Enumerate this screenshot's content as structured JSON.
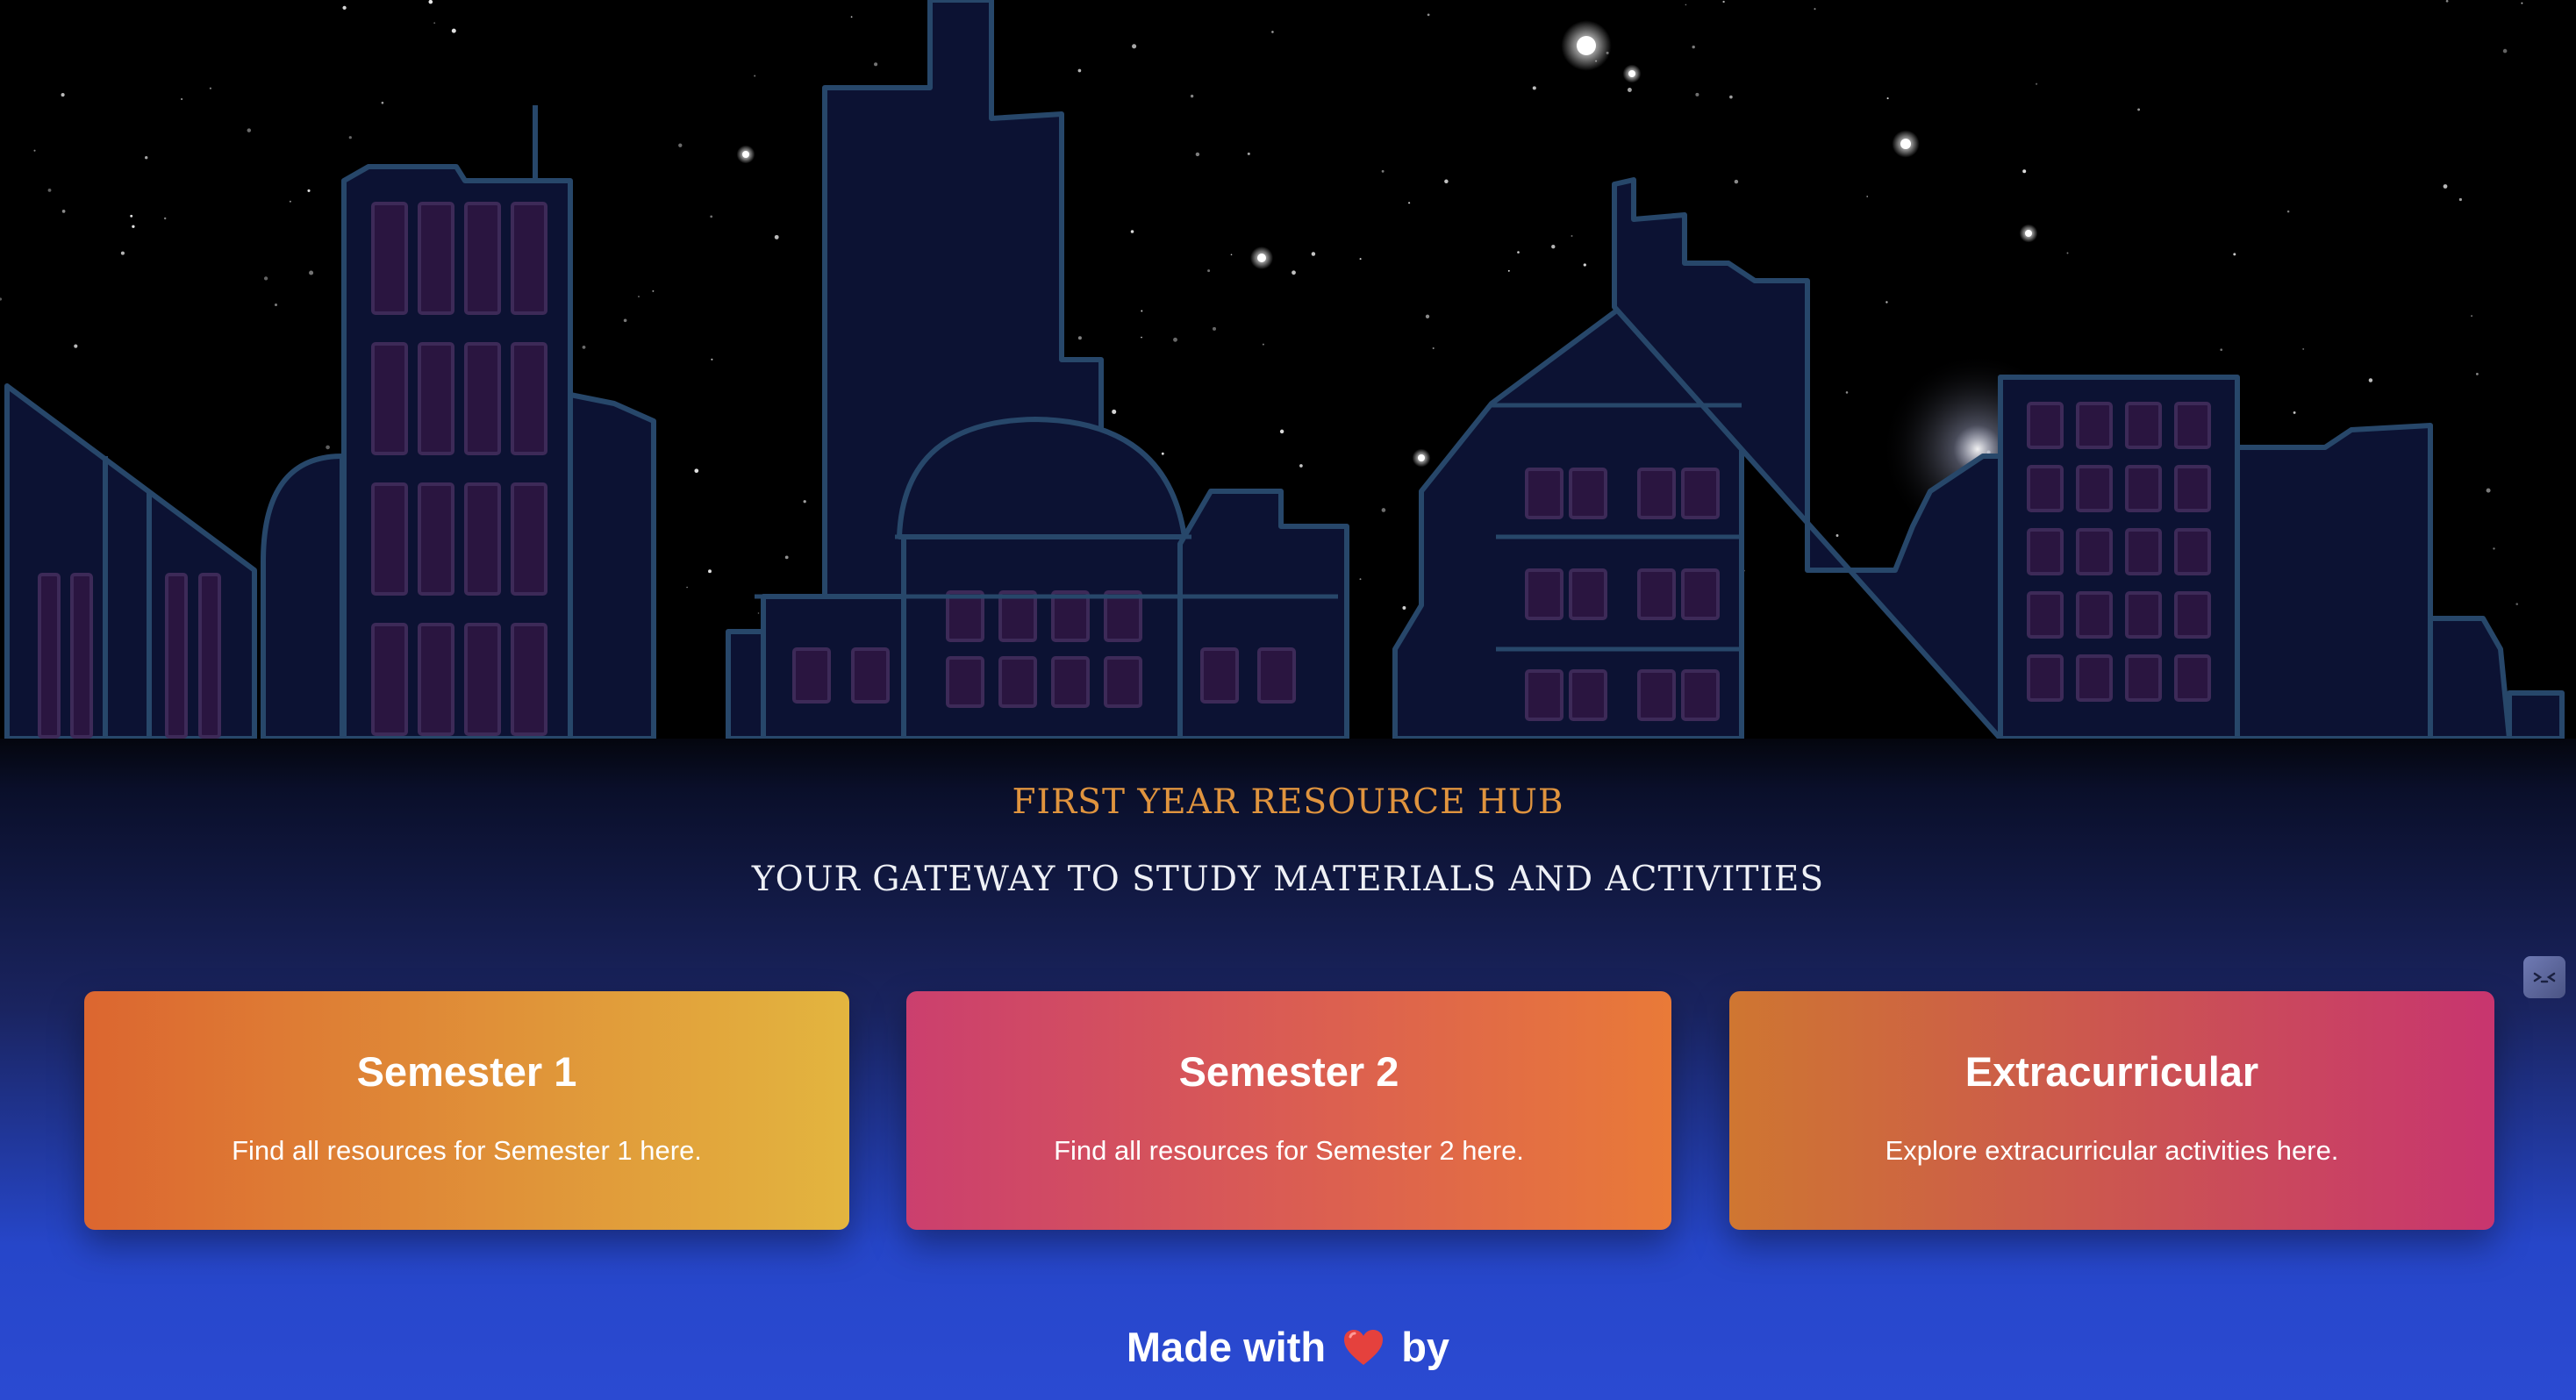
{
  "header": {
    "title": "FIRST YEAR RESOURCE HUB",
    "subtitle": "YOUR GATEWAY TO STUDY MATERIALS AND ACTIVITIES"
  },
  "cards": [
    {
      "title": "Semester 1",
      "description": "Find all resources for Semester 1 here."
    },
    {
      "title": "Semester 2",
      "description": "Find all resources for Semester 2 here."
    },
    {
      "title": "Extracurricular",
      "description": "Explore extracurricular activities here."
    }
  ],
  "footer": {
    "text_before": "Made with",
    "text_after": "by",
    "icon": "heart-icon"
  },
  "widget": {
    "icon": "ghost-face-icon"
  },
  "colors": {
    "title_accent": "#e0943e",
    "page_bottom": "#2b4ad2",
    "building_fill": "#0c1233",
    "building_outline": "#27476a",
    "window_fill": "#2a1540"
  }
}
